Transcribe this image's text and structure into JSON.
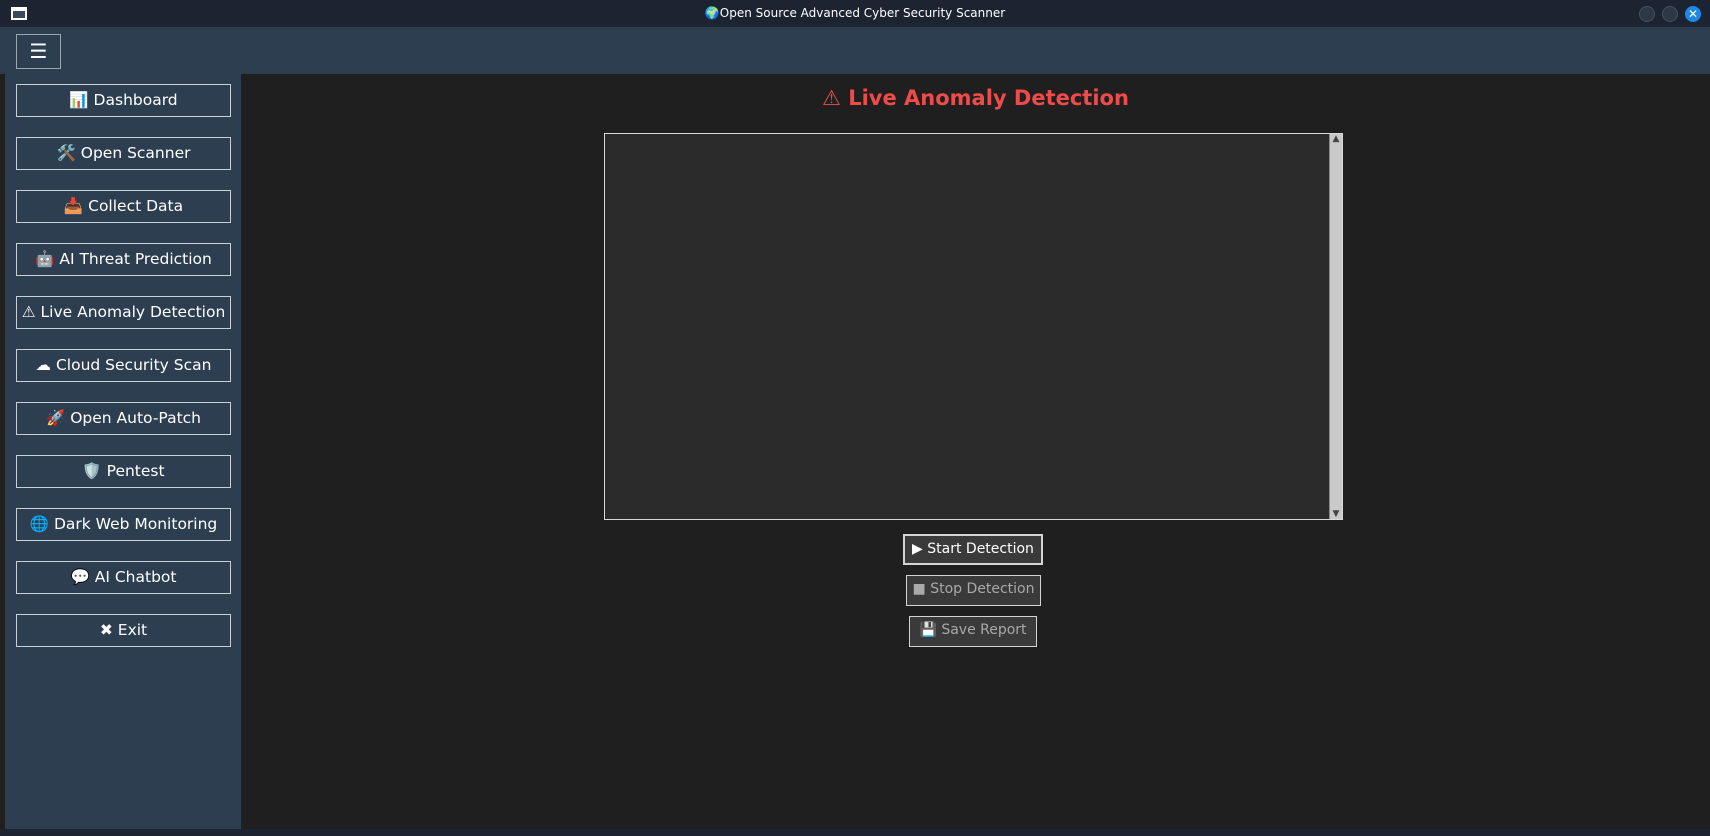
{
  "window": {
    "title": "🌍Open Source Advanced Cyber Security Scanner",
    "close_glyph": "✕"
  },
  "topbar": {
    "menu_glyph": "☰"
  },
  "sidebar": {
    "items": [
      {
        "label": "📊 Dashboard"
      },
      {
        "label": "🛠️ Open Scanner"
      },
      {
        "label": "📥 Collect Data"
      },
      {
        "label": "🤖 AI Threat Prediction"
      },
      {
        "label": "⚠ Live Anomaly Detection"
      },
      {
        "label": "☁ Cloud Security Scan"
      },
      {
        "label": "🚀 Open Auto-Patch"
      },
      {
        "label": "🛡️ Pentest"
      },
      {
        "label": "🌐 Dark Web Monitoring"
      },
      {
        "label": "💬 AI Chatbot"
      },
      {
        "label": "✖ Exit"
      }
    ]
  },
  "main": {
    "heading": "⚠ Live Anomaly Detection",
    "log_text": "",
    "buttons": {
      "start": "▶ Start Detection",
      "stop": "■ Stop Detection",
      "save": "💾 Save Report"
    }
  },
  "colors": {
    "sidebar_bg": "#2c3e50",
    "main_bg": "#1f1f1f",
    "heading": "#ef4b4b",
    "accent_close": "#1e88e5"
  }
}
